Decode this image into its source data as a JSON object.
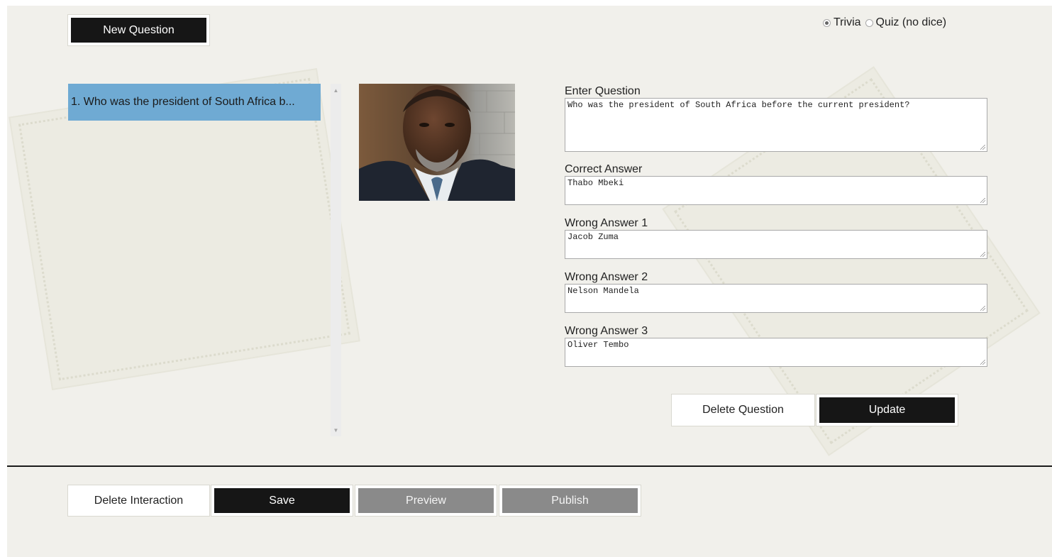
{
  "toolbar": {
    "new_question_label": "New Question"
  },
  "mode": {
    "options": [
      {
        "label": "Trivia",
        "checked": true
      },
      {
        "label": "Quiz (no dice)",
        "checked": false
      }
    ]
  },
  "question_list": {
    "items": [
      {
        "label": "1. Who was the president of South Africa b..."
      }
    ]
  },
  "form": {
    "question_label": "Enter Question",
    "question_value": "Who was the president of South Africa before the current president?",
    "correct_label": "Correct Answer",
    "correct_value": "Thabo Mbeki",
    "wrong1_label": "Wrong Answer 1",
    "wrong1_value": "Jacob Zuma",
    "wrong2_label": "Wrong Answer 2",
    "wrong2_value": "Nelson Mandela",
    "wrong3_label": "Wrong Answer 3",
    "wrong3_value": "Oliver Tembo",
    "delete_question_label": "Delete Question",
    "update_label": "Update"
  },
  "footer": {
    "delete_interaction_label": "Delete Interaction",
    "save_label": "Save",
    "preview_label": "Preview",
    "publish_label": "Publish"
  },
  "colors": {
    "background": "#f1f0eb",
    "selected_item": "#6faad3",
    "dark_button": "#161616",
    "disabled_button": "#8a8a8a"
  }
}
